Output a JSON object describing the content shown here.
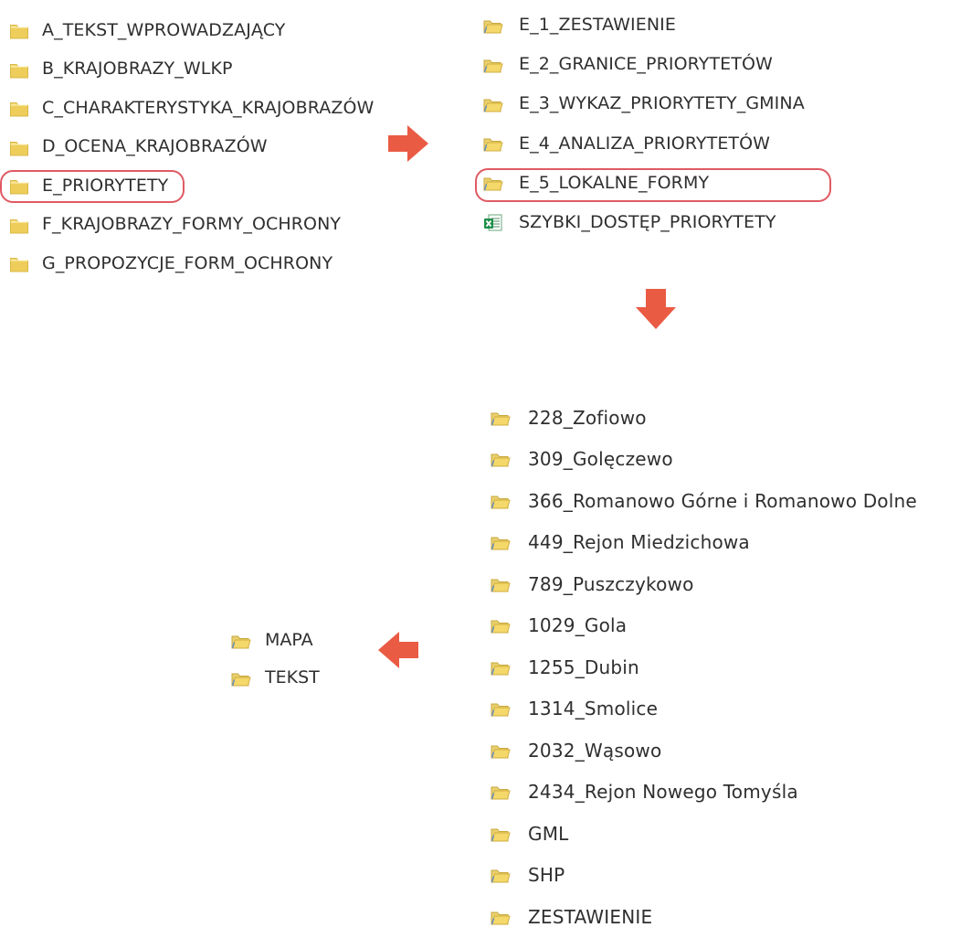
{
  "icons": {
    "folder": "folder-icon",
    "excel": "excel-file-icon",
    "arrow_right": "red-right-arrow-icon",
    "arrow_down": "red-down-arrow-icon",
    "arrow_left": "red-left-arrow-icon"
  },
  "colors": {
    "highlight": "#e05a63",
    "arrow": "#ea5b44",
    "folder_light": "#f4d86a",
    "folder_dark": "#e1b93b",
    "excel_green": "#1f8f4a"
  },
  "panels": {
    "root": {
      "items": [
        {
          "label": "A_TEKST_WPROWADZAJĄCY",
          "type": "folder"
        },
        {
          "label": "B_KRAJOBRAZY_WLKP",
          "type": "folder"
        },
        {
          "label": "C_CHARAKTERYSTYKA_KRAJOBRAZÓW",
          "type": "folder"
        },
        {
          "label": "D_OCENA_KRAJOBRAZÓW",
          "type": "folder"
        },
        {
          "label": "E_PRIORYTETY",
          "type": "folder",
          "highlighted": true
        },
        {
          "label": "F_KRAJOBRAZY_FORMY_OCHRONY",
          "type": "folder"
        },
        {
          "label": "G_PROPOZYCJE_FORM_OCHRONY",
          "type": "folder"
        }
      ]
    },
    "e_priorytety": {
      "items": [
        {
          "label": "E_1_ZESTAWIENIE",
          "type": "folder"
        },
        {
          "label": "E_2_GRANICE_PRIORYTETÓW",
          "type": "folder"
        },
        {
          "label": "E_3_WYKAZ_PRIORYTETY_GMINA",
          "type": "folder"
        },
        {
          "label": "E_4_ANALIZA_PRIORYTETÓW",
          "type": "folder"
        },
        {
          "label": "E_5_LOKALNE_FORMY",
          "type": "folder",
          "highlighted": true
        },
        {
          "label": "SZYBKI_DOSTĘP_PRIORYTETY",
          "type": "excel"
        }
      ]
    },
    "e5_lokalne_formy": {
      "items": [
        {
          "label": "228_Zofiowo",
          "type": "folder"
        },
        {
          "label": "309_Golęczewo",
          "type": "folder"
        },
        {
          "label": "366_Romanowo Górne i Romanowo Dolne",
          "type": "folder"
        },
        {
          "label": "449_Rejon Miedzichowa",
          "type": "folder"
        },
        {
          "label": "789_Puszczykowo",
          "type": "folder"
        },
        {
          "label": "1029_Gola",
          "type": "folder"
        },
        {
          "label": "1255_Dubin",
          "type": "folder"
        },
        {
          "label": "1314_Smolice",
          "type": "folder"
        },
        {
          "label": "2032_Wąsowo",
          "type": "folder"
        },
        {
          "label": "2434_Rejon Nowego Tomyśla",
          "type": "folder"
        },
        {
          "label": "GML",
          "type": "folder"
        },
        {
          "label": "SHP",
          "type": "folder"
        },
        {
          "label": "ZESTAWIENIE",
          "type": "folder"
        }
      ]
    },
    "local_form": {
      "items": [
        {
          "label": "MAPA",
          "type": "folder"
        },
        {
          "label": "TEKST",
          "type": "folder"
        }
      ]
    }
  }
}
